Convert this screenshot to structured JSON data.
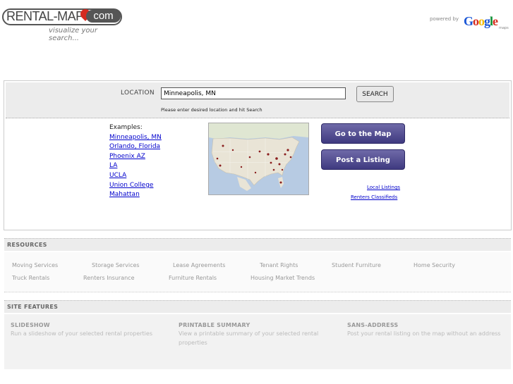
{
  "header": {
    "logo_text": "RENTAL-MAP",
    "logo_com": "com",
    "tagline": "visualize your search...",
    "powered_by": "powered by",
    "google_letters": [
      "G",
      "o",
      "o",
      "g",
      "l",
      "e"
    ],
    "maps_tag": "maps"
  },
  "search": {
    "label": "LOCATION",
    "value": "Minneapolis, MN",
    "button_label": "SEARCH",
    "hint": "Please enter desired location and hit Search"
  },
  "examples": {
    "title": "Examples:",
    "links": [
      "Minneapolis, MN",
      "Orlando, Florida",
      "Phoenix AZ",
      "LA",
      "UCLA",
      "Union College",
      "Mahattan"
    ]
  },
  "actions": {
    "go_to_map": "Go to the Map",
    "post_listing": "Post a Listing",
    "local_listings": "Local Listings",
    "renters_classifieds": "Renters Classifieds"
  },
  "resources": {
    "heading": "RESOURCES",
    "row1": [
      "Moving Services",
      "Storage Services",
      "Lease Agreements",
      "Tenant Rights",
      "Student Furniture",
      "Home Security"
    ],
    "row2": [
      "Truck Rentals",
      "Renters Insurance",
      "Furniture Rentals",
      "Housing Market Trends"
    ]
  },
  "features": {
    "heading": "SITE FEATURES",
    "items": [
      {
        "title": "SLIDESHOW",
        "desc": "Run a slideshow of your selected rental properties"
      },
      {
        "title": "PRINTABLE SUMMARY",
        "desc": "View a printable summary of your selected rental properties"
      },
      {
        "title": "SANS-ADDRESS",
        "desc": "Post your rental listing on the map without an address"
      }
    ]
  },
  "colors": {
    "link": "#0000cc",
    "button_purple": "#4a4589",
    "logo_pin": "#d42a20"
  }
}
